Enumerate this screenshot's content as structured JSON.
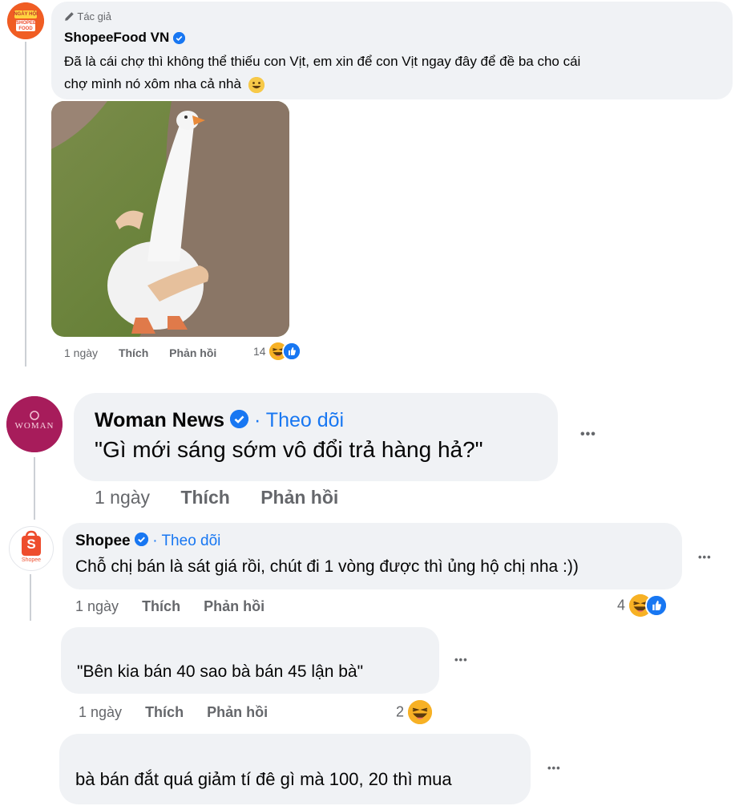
{
  "colors": {
    "bubble": "#f0f2f5",
    "meta": "#65676b",
    "link": "#1877f2",
    "text": "#050505"
  },
  "comments": [
    {
      "author_badge": "Tác giả",
      "author": "ShopeeFood VN",
      "verified": true,
      "text_line1": "Đã là cái chợ thì không thể thiếu con Vịt, em xin để con Vịt ngay đây để đề ba cho cái",
      "text_line2": "chợ mình nó xôm nha cả nhà",
      "emoji": "grinning-face",
      "attachment": "goose-with-hands-image",
      "time": "1 ngày",
      "like": "Thích",
      "reply": "Phản hồi",
      "reaction_count": "14",
      "avatar_text_top": "NGÀY HỘI",
      "avatar_text_bottom": "SHOPEE FOOD"
    },
    {
      "author": "Woman News",
      "verified": true,
      "follow": "· Theo dõi",
      "text": "\"Gì mới sáng sớm vô đổi trả hàng hả?\"",
      "time": "1 ngày",
      "like": "Thích",
      "reply": "Phản hồi",
      "more": "•••",
      "avatar_text": "WOMAN"
    },
    {
      "author": "Shopee",
      "verified": true,
      "follow": "· Theo dõi",
      "text": "Chỗ chị bán là sát giá rồi, chút đi 1 vòng được thì ủng hộ chị nha :))",
      "time": "1 ngày",
      "like": "Thích",
      "reply": "Phản hồi",
      "reaction_count": "4",
      "more": "•••",
      "avatar_letter": "S",
      "avatar_text": "Shopee"
    },
    {
      "text": "\"Bên kia bán 40 sao bà bán 45 lận bà\"",
      "time": "1 ngày",
      "like": "Thích",
      "reply": "Phản hồi",
      "reaction_count": "2",
      "more": "•••"
    },
    {
      "text": "bà bán đắt quá giảm tí đê gì mà 100, 20 thì mua",
      "more": "•••"
    }
  ]
}
